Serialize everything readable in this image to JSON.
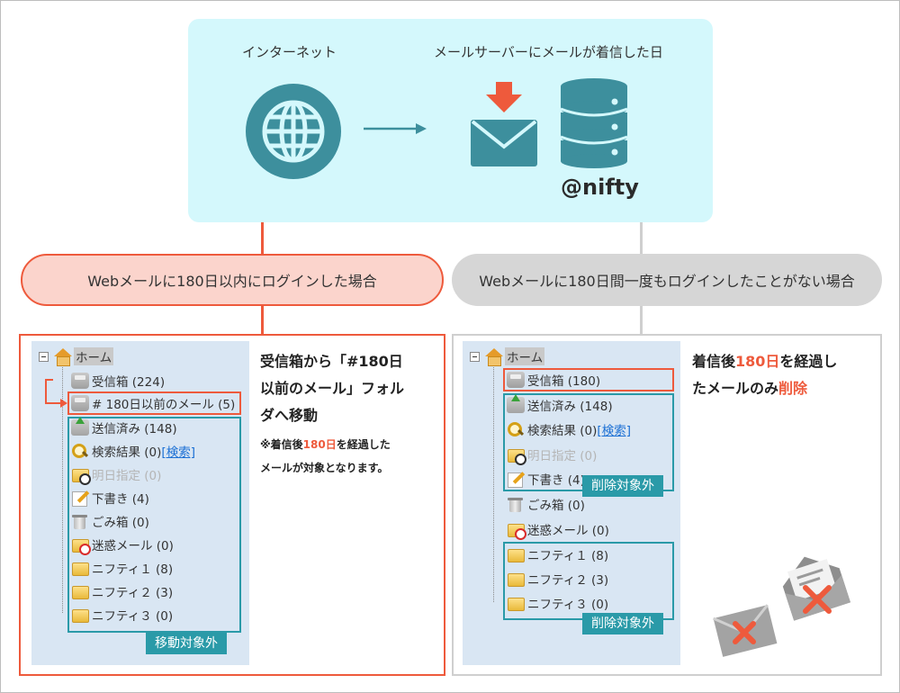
{
  "top": {
    "internet_label": "インターネット",
    "server_label": "メールサーバーにメールが着信した日",
    "nifty_logo": "@nifty",
    "icons": [
      "globe-icon",
      "arrow-right-icon",
      "download-arrow-icon",
      "envelope-icon",
      "database-icon"
    ]
  },
  "colors": {
    "top_panel_bg": "#d4f8fc",
    "teal_icon": "#3d8f9d",
    "accent_red": "#ee5a3c",
    "teal_frame": "#2a9aa8",
    "pill_left_bg": "#fbd4cc",
    "pill_right_bg": "#d6d6d6",
    "tree_bg": "#d9e6f3"
  },
  "branches": {
    "left": "Webメールに180日以内にログインした場合",
    "right": "Webメールに180日間一度もログインしたことがない場合"
  },
  "left_tree": {
    "home": "ホーム",
    "inbox": "受信箱 (224)",
    "moved": "# 180日以前のメール (5)",
    "items": [
      {
        "label": "送信済み (148)"
      },
      {
        "label": "検索結果 (0)",
        "link": "[検索]"
      },
      {
        "label": "明日指定 (0)"
      },
      {
        "label": "下書き (4)"
      },
      {
        "label": "ごみ箱 (0)"
      },
      {
        "label": "迷惑メール (0)"
      },
      {
        "label": "ニフティ１ (8)"
      },
      {
        "label": "ニフティ２ (3)"
      },
      {
        "label": "ニフティ３ (0)"
      }
    ],
    "tag": "移動対象外"
  },
  "left_desc": {
    "line1": "受信箱から「#180日",
    "line2": "以前のメール」フォル",
    "line3": "ダへ移動",
    "note_prefix": "※着信後",
    "note_hl": "180日",
    "note_suffix": "を経過した",
    "note_line2": "メールが対象となります。"
  },
  "right_tree": {
    "home": "ホーム",
    "inbox": "受信箱 (180)",
    "items": [
      {
        "label": "送信済み (148)"
      },
      {
        "label": "検索結果 (0)",
        "link": "[検索]"
      },
      {
        "label": "明日指定 (0)"
      },
      {
        "label": "下書き (4)"
      },
      {
        "label": "ごみ箱 (0)"
      },
      {
        "label": "迷惑メール (0)"
      },
      {
        "label": "ニフティ１ (8)"
      },
      {
        "label": "ニフティ２ (3)"
      },
      {
        "label": "ニフティ３ (0)"
      }
    ],
    "tag1": "削除対象外",
    "tag2": "削除対象外"
  },
  "right_desc": {
    "l1_prefix": "着信後",
    "l1_hl": "180日",
    "l1_suffix": "を経過し",
    "l2_prefix": "たメールのみ",
    "l2_hl": "削除"
  }
}
